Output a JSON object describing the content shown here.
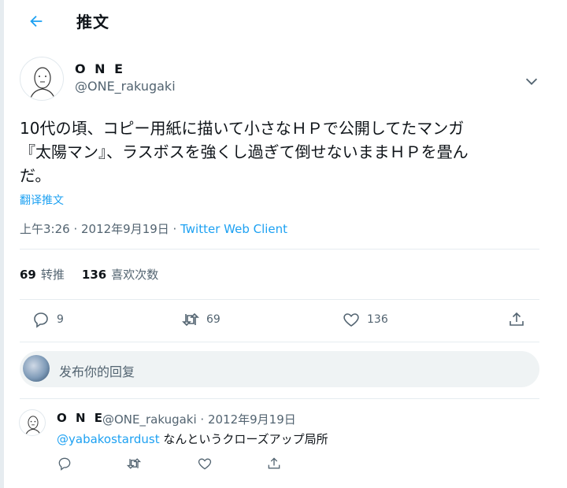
{
  "header": {
    "title": "推文"
  },
  "tweet": {
    "author_name": "O N E",
    "author_handle": "@ONE_rakugaki",
    "text_line1": "10代の頃、コピー用紙に描いて小さなＨＰで公開してたマンガ",
    "text_line2": "『太陽マン』、ラスボスを強くし過ぎて倒せないままＨＰを畳ん",
    "text_line3": "だ。",
    "translate_label": "翻译推文",
    "time": "上午3:26 · 2012年9月19日 · ",
    "client": "Twitter Web Client",
    "retweets_count": "69",
    "retweets_label": "转推",
    "likes_count": "136",
    "likes_label": "喜欢次数",
    "action_reply_count": "9",
    "action_retweet_count": "69",
    "action_like_count": "136"
  },
  "reply_box": {
    "placeholder": "发布你的回复"
  },
  "reply": {
    "author_name": "O N E",
    "meta": "@ONE_rakugaki · 2012年9月19日",
    "mention": "@yabakostardust",
    "text": " なんというクローズアップ局所"
  },
  "colors": {
    "accent": "#1da1f2",
    "muted": "#536471",
    "divider": "#e6ecf0"
  },
  "icons": [
    "back-arrow-icon",
    "chevron-down-icon",
    "reply-icon",
    "retweet-icon",
    "like-icon",
    "share-icon"
  ]
}
